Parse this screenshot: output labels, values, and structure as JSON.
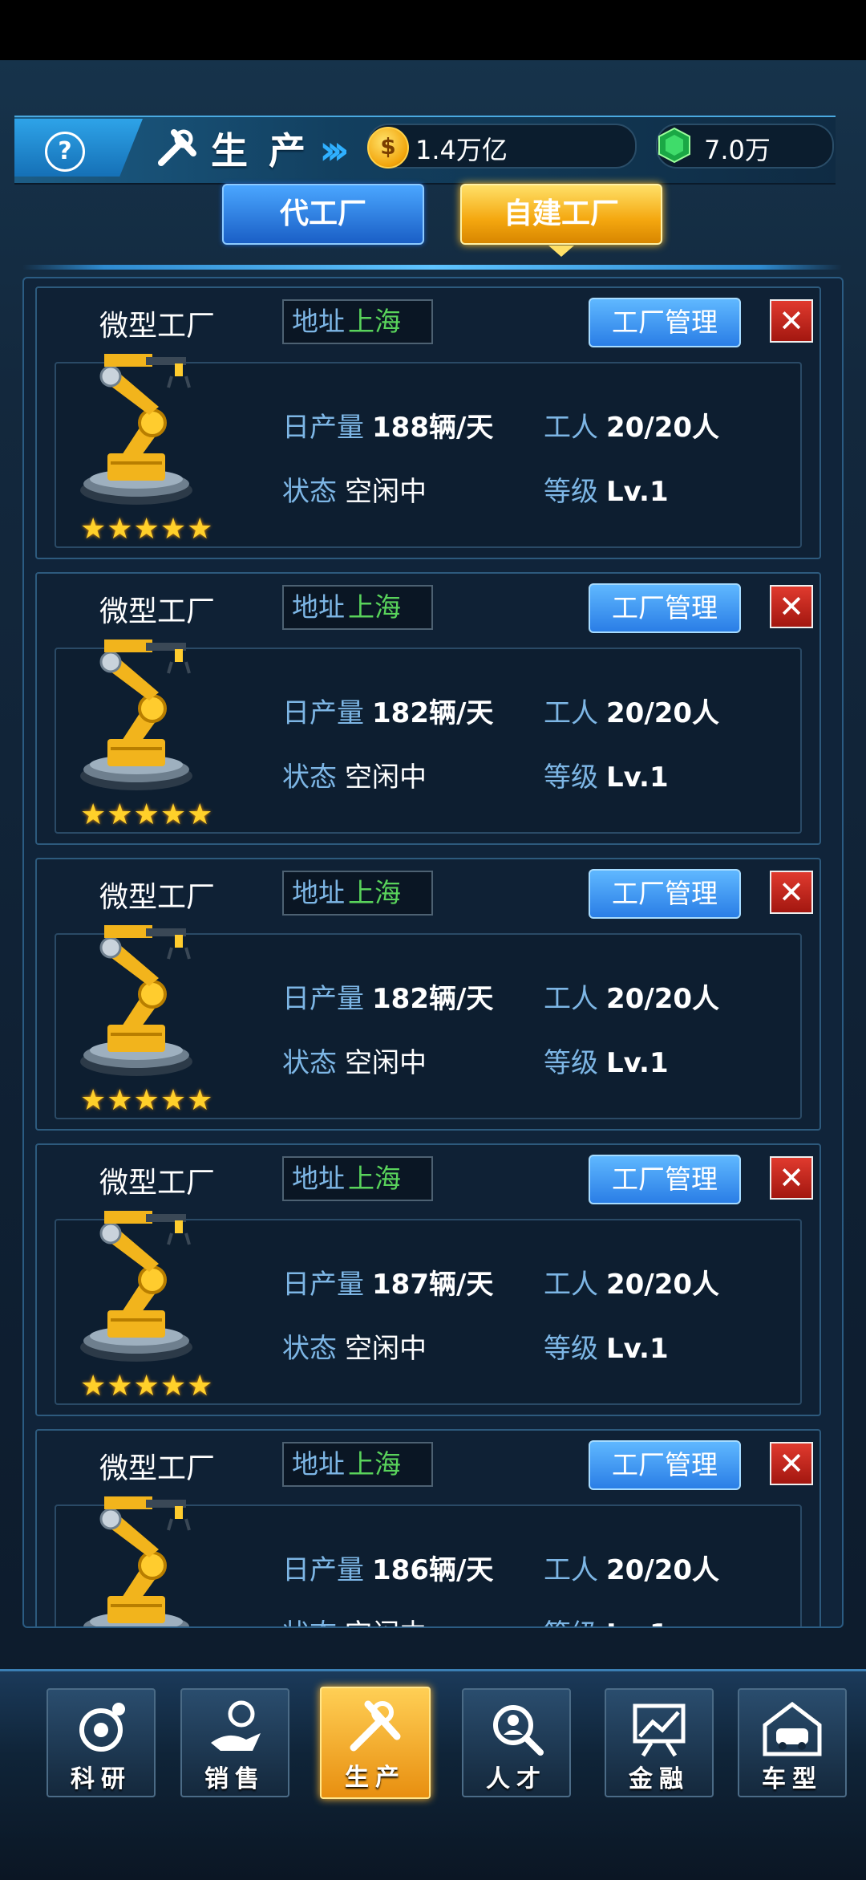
{
  "header": {
    "help_icon": "?",
    "title": "生产",
    "gold_value": "1.4万亿",
    "gem_value": "7.0万",
    "coin_symbol": "$"
  },
  "tabs": [
    {
      "label": "代工厂",
      "selected": false
    },
    {
      "label": "自建工厂",
      "selected": true
    }
  ],
  "factories": [
    {
      "name": "微型工厂",
      "address_label": "地址",
      "city": "上海",
      "manage_label": "工厂管理",
      "output_label": "日产量",
      "output_value": "188辆/天",
      "workers_label": "工人",
      "workers_value": "20/20人",
      "status_label": "状态",
      "status_value": "空闲中",
      "level_label": "等级",
      "level_value": "Lv.1",
      "stars": "★★★★★"
    },
    {
      "name": "微型工厂",
      "address_label": "地址",
      "city": "上海",
      "manage_label": "工厂管理",
      "output_label": "日产量",
      "output_value": "182辆/天",
      "workers_label": "工人",
      "workers_value": "20/20人",
      "status_label": "状态",
      "status_value": "空闲中",
      "level_label": "等级",
      "level_value": "Lv.1",
      "stars": "★★★★★"
    },
    {
      "name": "微型工厂",
      "address_label": "地址",
      "city": "上海",
      "manage_label": "工厂管理",
      "output_label": "日产量",
      "output_value": "182辆/天",
      "workers_label": "工人",
      "workers_value": "20/20人",
      "status_label": "状态",
      "status_value": "空闲中",
      "level_label": "等级",
      "level_value": "Lv.1",
      "stars": "★★★★★"
    },
    {
      "name": "微型工厂",
      "address_label": "地址",
      "city": "上海",
      "manage_label": "工厂管理",
      "output_label": "日产量",
      "output_value": "187辆/天",
      "workers_label": "工人",
      "workers_value": "20/20人",
      "status_label": "状态",
      "status_value": "空闲中",
      "level_label": "等级",
      "level_value": "Lv.1",
      "stars": "★★★★★"
    },
    {
      "name": "微型工厂",
      "address_label": "地址",
      "city": "上海",
      "manage_label": "工厂管理",
      "output_label": "日产量",
      "output_value": "186辆/天",
      "workers_label": "工人",
      "workers_value": "20/20人",
      "status_label": "状态",
      "status_value": "空闲中",
      "level_label": "等级",
      "level_value": "Lv.1",
      "stars": "★★★★★"
    }
  ],
  "close_symbol": "✕",
  "nav": [
    {
      "label": "科研",
      "icon": "research-icon",
      "active": false
    },
    {
      "label": "销售",
      "icon": "sales-icon",
      "active": false
    },
    {
      "label": "生产",
      "icon": "production-icon",
      "active": true
    },
    {
      "label": "人才",
      "icon": "talent-icon",
      "active": false
    },
    {
      "label": "金融",
      "icon": "finance-icon",
      "active": false
    },
    {
      "label": "车型",
      "icon": "car-model-icon",
      "active": false
    }
  ],
  "colors": {
    "accent_gold": "#f4a70f",
    "accent_blue": "#2a7ee6",
    "city_green": "#59d35b",
    "label_blue": "#7db6e5",
    "close_red": "#c8261b"
  }
}
